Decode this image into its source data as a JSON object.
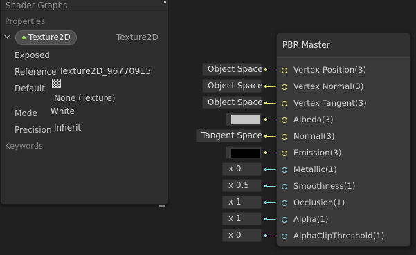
{
  "blackboard": {
    "title": "Shader Graphs",
    "sections": {
      "properties": "Properties",
      "keywords": "Keywords"
    },
    "property": {
      "name": "Texture2D",
      "type": "Texture2D",
      "fields": [
        {
          "label": "Exposed",
          "value": ""
        },
        {
          "label": "Reference",
          "value": "Texture2D_96770915"
        },
        {
          "label": "Default",
          "value": "None (Texture)"
        },
        {
          "label": "Mode",
          "value": "White"
        },
        {
          "label": "Precision",
          "value": "Inherit"
        }
      ]
    }
  },
  "inputs": {
    "vertex_position": "Object Space",
    "vertex_normal": "Object Space",
    "vertex_tangent": "Object Space",
    "normal": "Tangent Space",
    "metallic": "x 0",
    "smoothness": "x 0.5",
    "occlusion": "x 1",
    "alpha": "x 1",
    "alpha_clip": "x 0",
    "albedo_color": "#c6c6c6",
    "emission_color": "#000000"
  },
  "node": {
    "title": "PBR Master",
    "slots": [
      "Vertex Position(3)",
      "Vertex Normal(3)",
      "Vertex Tangent(3)",
      "Albedo(3)",
      "Normal(3)",
      "Emission(3)",
      "Metallic(1)",
      "Smoothness(1)",
      "Occlusion(1)",
      "Alpha(1)",
      "AlphaClipThreshold(1)"
    ]
  },
  "colors": {
    "vector3_port": "#e7e270",
    "vector1_port": "#8ed6e8",
    "exposed_dot": "#9ad35c"
  }
}
